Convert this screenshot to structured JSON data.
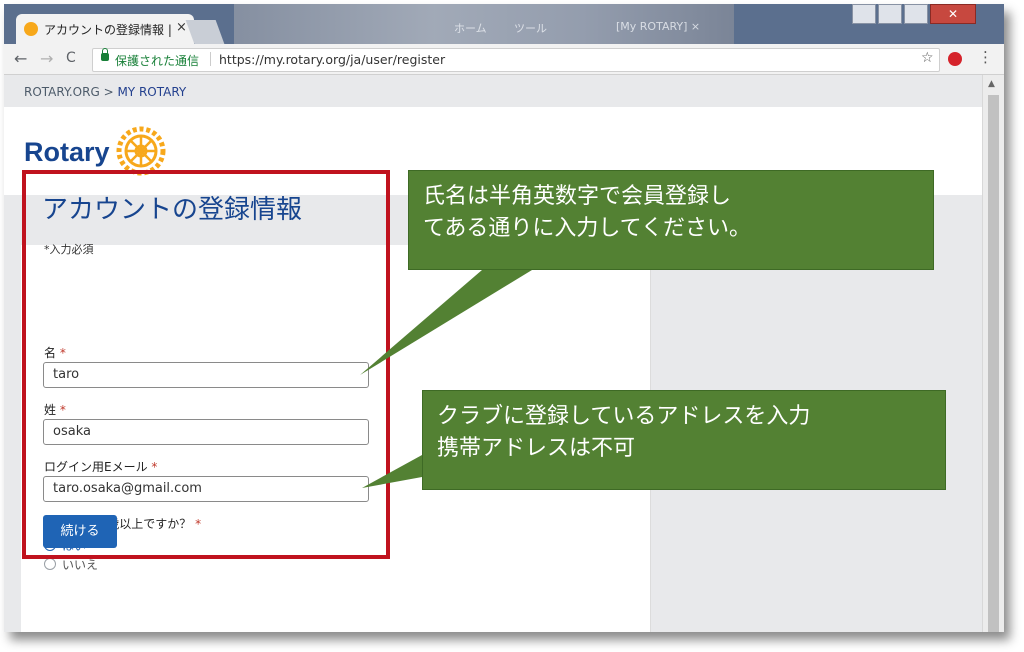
{
  "browser": {
    "tab_title": "アカウントの登録情報 |",
    "tab_close": "×",
    "bg_texts": [
      "ホーム",
      "ツール",
      "[My ROTARY] ×"
    ],
    "window_close": "✕",
    "secure_label": "保護された通信",
    "url": "https://my.rotary.org/ja/user/register",
    "nav": {
      "back": "←",
      "forward": "→",
      "reload": "C"
    },
    "star": "☆",
    "kebab": "⋮"
  },
  "page": {
    "breadcrumb_root": "ROTARY.ORG >",
    "breadcrumb_current": "MY ROTARY",
    "logo_text": "Rotary"
  },
  "form": {
    "title": "アカウントの登録情報",
    "required_note": "*入力必須",
    "first_name": {
      "label": "名",
      "asterisk": "*",
      "value": "taro"
    },
    "last_name": {
      "label": "姓",
      "asterisk": "*",
      "value": "osaka"
    },
    "email": {
      "label": "ログイン用Eメール",
      "asterisk": "*",
      "value": "taro.osaka@gmail.com"
    },
    "age_question": {
      "label": "あなたは18歳以上ですか？",
      "asterisk": "*"
    },
    "age_options": [
      {
        "label": "はい",
        "selected": true
      },
      {
        "label": "いいえ",
        "selected": false
      }
    ],
    "continue_label": "続ける"
  },
  "annotations": {
    "callout1_line1": "氏名は半角英数字で会員登録し",
    "callout1_line2": "てある通りに入力してください。",
    "callout2_line1": "クラブに登録しているアドレスを入力",
    "callout2_line2": "携帯アドレスは不可"
  },
  "colors": {
    "brand_blue": "#17458f",
    "button_blue": "#1f64b5",
    "callout_green": "#538133",
    "highlight_red": "#c0121e",
    "rotary_gold": "#f7a81b"
  }
}
